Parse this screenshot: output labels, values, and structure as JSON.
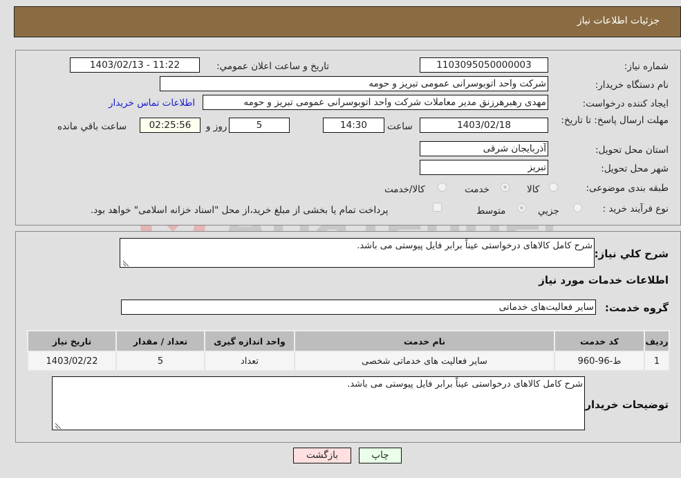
{
  "header": {
    "title": "جزئیات اطلاعات نیاز"
  },
  "form": {
    "need_number": {
      "label": "شماره نیاز:",
      "value": "1103095050000003"
    },
    "announce_datetime": {
      "label": "تاریخ و ساعت اعلان عمومي:",
      "value": "1403/02/13 - 11:22"
    },
    "buyer_org": {
      "label": "نام دستگاه خریدار:",
      "value": "شرکت واحد اتوبوسرانی عمومی تبریز و حومه"
    },
    "requester": {
      "label": "ایجاد کننده درخواست:",
      "value": "مهدی رهبرهرزنق مدیر معاملات شرکت واحد اتوبوسرانی عمومی تبریز و حومه"
    },
    "contact_link": "اطلاعات تماس خریدار",
    "deadline": {
      "label": "مهلت ارسال پاسخ: تا تاریخ:",
      "date": "1403/02/18",
      "time_label": "ساعت",
      "time": "14:30",
      "days": "5",
      "days_label": "روز و",
      "remaining": "02:25:56",
      "remaining_label": "ساعت باقي مانده"
    },
    "province": {
      "label": "استان محل تحویل:",
      "value": "آذربایجان شرقی"
    },
    "city": {
      "label": "شهر محل تحویل:",
      "value": "تبریز"
    },
    "category": {
      "label": "طبقه بندی موضوعی:",
      "options": [
        "کالا",
        "خدمت",
        "کالا/خدمت"
      ],
      "selected": "خدمت"
    },
    "process": {
      "label": "نوع فرآیند خرید :",
      "options": [
        "جزیي",
        "متوسط"
      ],
      "selected": "متوسط",
      "checkbox_label": "پرداخت تمام یا بخشی از مبلغ خرید،از محل \"اسناد خزانه اسلامی\" خواهد بود.",
      "checkbox_checked": false
    }
  },
  "details": {
    "general_desc_label": "شرح کلي نیاز:",
    "general_desc": "شرح کامل کالاهای درخواستی عیناً برابر فایل پیوستی می باشد.",
    "services_title": "اطلاعات خدمات مورد نیاز",
    "service_group_label": "گروه خدمت:",
    "service_group": "سایر فعالیت‌های خدماتی",
    "table": {
      "headers": [
        "ردیف",
        "کد خدمت",
        "نام خدمت",
        "واحد اندازه گیری",
        "تعداد / مقدار",
        "تاریخ نیاز"
      ],
      "rows": [
        [
          "1",
          "ط-96-960",
          "سایر فعالیت های خدماتی شخصی",
          "تعداد",
          "5",
          "1403/02/22"
        ]
      ]
    },
    "buyer_notes_label": "توضیحات خریدار:",
    "buyer_notes": "شرح کامل کالاهای درخواستی عیناً برابر فایل پیوستی می باشد."
  },
  "buttons": {
    "print": "چاپ",
    "back": "بازگشت"
  },
  "watermark": {
    "text": "AriaTender.net",
    "colors": {
      "shield": "#e8b4b4",
      "text": "#b9b9b9"
    }
  }
}
